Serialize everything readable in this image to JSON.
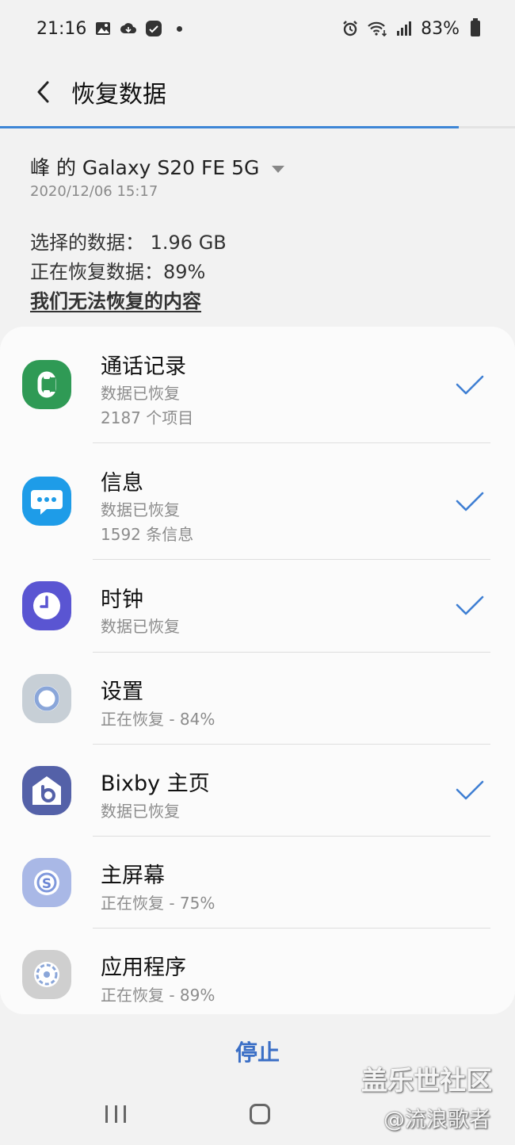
{
  "status_bar": {
    "time": "21:16",
    "battery": "83%",
    "icons": [
      "image-icon",
      "cloud-icon",
      "app-icon",
      "alarm-icon",
      "wifi-icon",
      "signal-icon",
      "battery-icon"
    ]
  },
  "header": {
    "title": "恢复数据",
    "back_icon": "chevron-left-icon"
  },
  "progress": {
    "fraction": 0.89,
    "color": "#3e86d6"
  },
  "device": {
    "name": "峰 的 Galaxy S20 FE 5G",
    "date": "2020/12/06 15:17"
  },
  "summary": {
    "selected_data": "选择的数据： 1.96 GB",
    "restoring": "正在恢复数据：89%",
    "cant_restore_link": "我们无法恢复的内容"
  },
  "items": [
    {
      "title": "通话记录",
      "status": "数据已恢复",
      "detail": "2187 个项目",
      "done": true,
      "icon": "phone-icon",
      "icon_bg": "#2f9a55"
    },
    {
      "title": "信息",
      "status": "数据已恢复",
      "detail": "1592 条信息",
      "done": true,
      "icon": "message-icon",
      "icon_bg": "#1e9ce8"
    },
    {
      "title": "时钟",
      "status": "数据已恢复",
      "done": true,
      "icon": "clock-icon",
      "icon_bg": "#5a55d2"
    },
    {
      "title": "设置",
      "status": "正在恢复 - 84%",
      "done": false,
      "icon": "gear-icon",
      "icon_bg": "#c7cfd6"
    },
    {
      "title": "Bixby 主页",
      "status": "数据已恢复",
      "done": true,
      "icon": "bixby-icon",
      "icon_bg": "#5461a8"
    },
    {
      "title": "主屏幕",
      "status": "正在恢复 - 75%",
      "done": false,
      "icon": "home-screen-icon",
      "icon_bg": "#a9b8e6"
    },
    {
      "title": "应用程序",
      "status": "正在恢复 - 89%",
      "done": false,
      "icon": "apps-icon",
      "icon_bg": "#cfcfcf"
    }
  ],
  "stop_label": "停止",
  "watermark": {
    "line1": "盖乐世社区",
    "line2": "@流浪歌者"
  },
  "colors": {
    "accent": "#3b6fc6",
    "check": "#3f7fd3"
  }
}
